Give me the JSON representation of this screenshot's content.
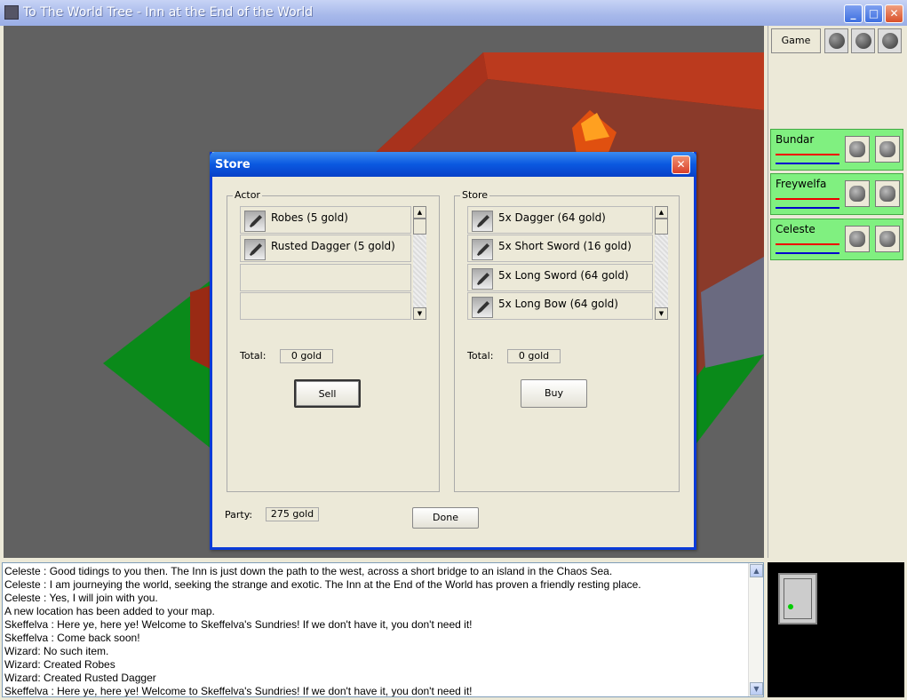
{
  "window": {
    "title": "To The World Tree - Inn at the End of the World",
    "min": "_",
    "max": "□",
    "close": "✕"
  },
  "sidepanel": {
    "game_label": "Game",
    "icons": [
      "options-icon",
      "party-icon",
      "undo-icon"
    ],
    "party": [
      {
        "name": "Bundar"
      },
      {
        "name": "Freywelfa"
      },
      {
        "name": "Celeste"
      }
    ]
  },
  "store_dialog": {
    "title": "Store",
    "close": "✕",
    "actor": {
      "label": "Actor",
      "items": [
        "Robes (5 gold)",
        "Rusted Dagger (5 gold)",
        "",
        ""
      ],
      "total_label": "Total:",
      "total_value": "0 gold",
      "sell_label": "Sell"
    },
    "store": {
      "label": "Store",
      "items": [
        "5x Dagger (64 gold)",
        "5x Short Sword (16 gold)",
        "5x Long Sword (64 gold)",
        "5x Long Bow (64 gold)"
      ],
      "total_label": "Total:",
      "total_value": "0 gold",
      "buy_label": "Buy"
    },
    "party_label": "Party:",
    "party_gold": "275 gold",
    "done_label": "Done"
  },
  "log": [
    "Celeste : Good tidings to you then. The Inn is just down the path to the west, across a short bridge to an island in the Chaos Sea.",
    "Celeste : I am journeying the world, seeking the strange and exotic. The Inn at the End of the World has proven a friendly resting place.",
    "Celeste : Yes, I will join with you.",
    "A new location has been added to your map.",
    "Skeffelva : Here ye, here ye! Welcome to Skeffelva's Sundries! If we don't have it, you don't need it!",
    "Skeffelva : Come back soon!",
    "Wizard: No such item.",
    "Wizard: Created Robes",
    "Wizard: Created Rusted Dagger",
    "Skeffelva : Here ye, here ye! Welcome to Skeffelva's Sundries! If we don't have it, you don't need it!"
  ],
  "colors": {
    "party_card": "#80f080",
    "hp": "#e00000",
    "mp": "#0000cc",
    "dialog_border": "#0a3bd8"
  }
}
